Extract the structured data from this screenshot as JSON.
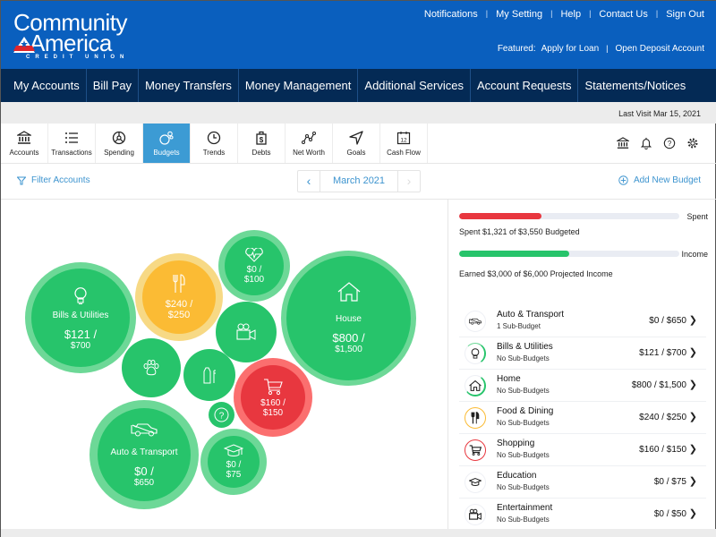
{
  "brand": {
    "line1": "Community",
    "line2": "America",
    "line3": "CREDIT UNION",
    "color_primary": "#0a5fbe",
    "color_nav": "#042a55"
  },
  "top_links": [
    "Notifications",
    "My Setting",
    "Help",
    "Contact Us",
    "Sign Out"
  ],
  "featured": {
    "label": "Featured:",
    "links": [
      "Apply for Loan",
      "Open Deposit Account"
    ]
  },
  "main_nav": [
    "My Accounts",
    "Bill Pay",
    "Money Transfers",
    "Money Management",
    "Additional Services",
    "Account Requests",
    "Statements/Notices"
  ],
  "last_visit": "Last Visit Mar 15, 2021",
  "tools": [
    {
      "label": "Accounts",
      "icon": "bank-icon"
    },
    {
      "label": "Transactions",
      "icon": "list-icon"
    },
    {
      "label": "Spending",
      "icon": "spending-icon"
    },
    {
      "label": "Budgets",
      "icon": "budgets-icon",
      "active": true
    },
    {
      "label": "Trends",
      "icon": "clock-icon"
    },
    {
      "label": "Debts",
      "icon": "debt-bag-icon"
    },
    {
      "label": "Net Worth",
      "icon": "net-worth-icon"
    },
    {
      "label": "Goals",
      "icon": "navigation-arrow-icon"
    },
    {
      "label": "Cash Flow",
      "icon": "calendar-icon",
      "badge": "12"
    }
  ],
  "filter": {
    "label": "Filter Accounts"
  },
  "month_nav": {
    "month": "March 2021",
    "prev": "‹",
    "next": "›"
  },
  "add_budget": {
    "label": "Add New Budget"
  },
  "bubbles": {
    "bills": {
      "name": "Bills & Utilities",
      "a1": "$121 /",
      "a2": "$700"
    },
    "food": {
      "a1": "$240 /",
      "a2": "$250"
    },
    "health": {
      "a1": "$0 /",
      "a2": "$100"
    },
    "house": {
      "name": "House",
      "a1": "$800 /",
      "a2": "$1,500"
    },
    "shopping": {
      "a1": "$160 /",
      "a2": "$150"
    },
    "auto": {
      "name": "Auto & Transport",
      "a1": "$0 /",
      "a2": "$650"
    },
    "education": {
      "a1": "$0 /",
      "a2": "$75"
    },
    "unknown": {
      "symbol": "?"
    }
  },
  "summary": {
    "spent": {
      "label": "Spent",
      "text": "Spent $1,321 of $3,550 Budgeted",
      "progress": 0.372,
      "color": "#e8373f"
    },
    "income": {
      "label": "Income",
      "text": "Earned $3,000 of $6,000 Projected Income",
      "progress": 0.5,
      "color": "#27c46b"
    }
  },
  "budgets": [
    {
      "name": "Auto & Transport",
      "sub": "1 Sub-Budget",
      "amount": "$0 / $650",
      "icon": "car-icon",
      "status": "none"
    },
    {
      "name": "Bills & Utilities",
      "sub": "No Sub-Budgets",
      "amount": "$121 / $700",
      "icon": "lightbulb-icon",
      "status": "green"
    },
    {
      "name": "Home",
      "sub": "No Sub-Budgets",
      "amount": "$800 / $1,500",
      "icon": "home-icon",
      "status": "green"
    },
    {
      "name": "Food & Dining",
      "sub": "No Sub-Budgets",
      "amount": "$240 / $250",
      "icon": "utensils-icon",
      "status": "yellow"
    },
    {
      "name": "Shopping",
      "sub": "No Sub-Budgets",
      "amount": "$160 / $150",
      "icon": "cart-icon",
      "status": "red"
    },
    {
      "name": "Education",
      "sub": "No Sub-Budgets",
      "amount": "$0 / $75",
      "icon": "graduation-cap-icon",
      "status": "none"
    },
    {
      "name": "Entertainment",
      "sub": "No Sub-Budgets",
      "amount": "$0 / $50",
      "icon": "video-camera-icon",
      "status": "none"
    }
  ],
  "colors": {
    "green": "#27c46b",
    "green_light": "#6dd897",
    "yellow": "#fbbb34",
    "yellow_light": "#f7d985",
    "red": "#e8373f",
    "red_light": "#fb6f6f",
    "link": "#3d94cf"
  }
}
